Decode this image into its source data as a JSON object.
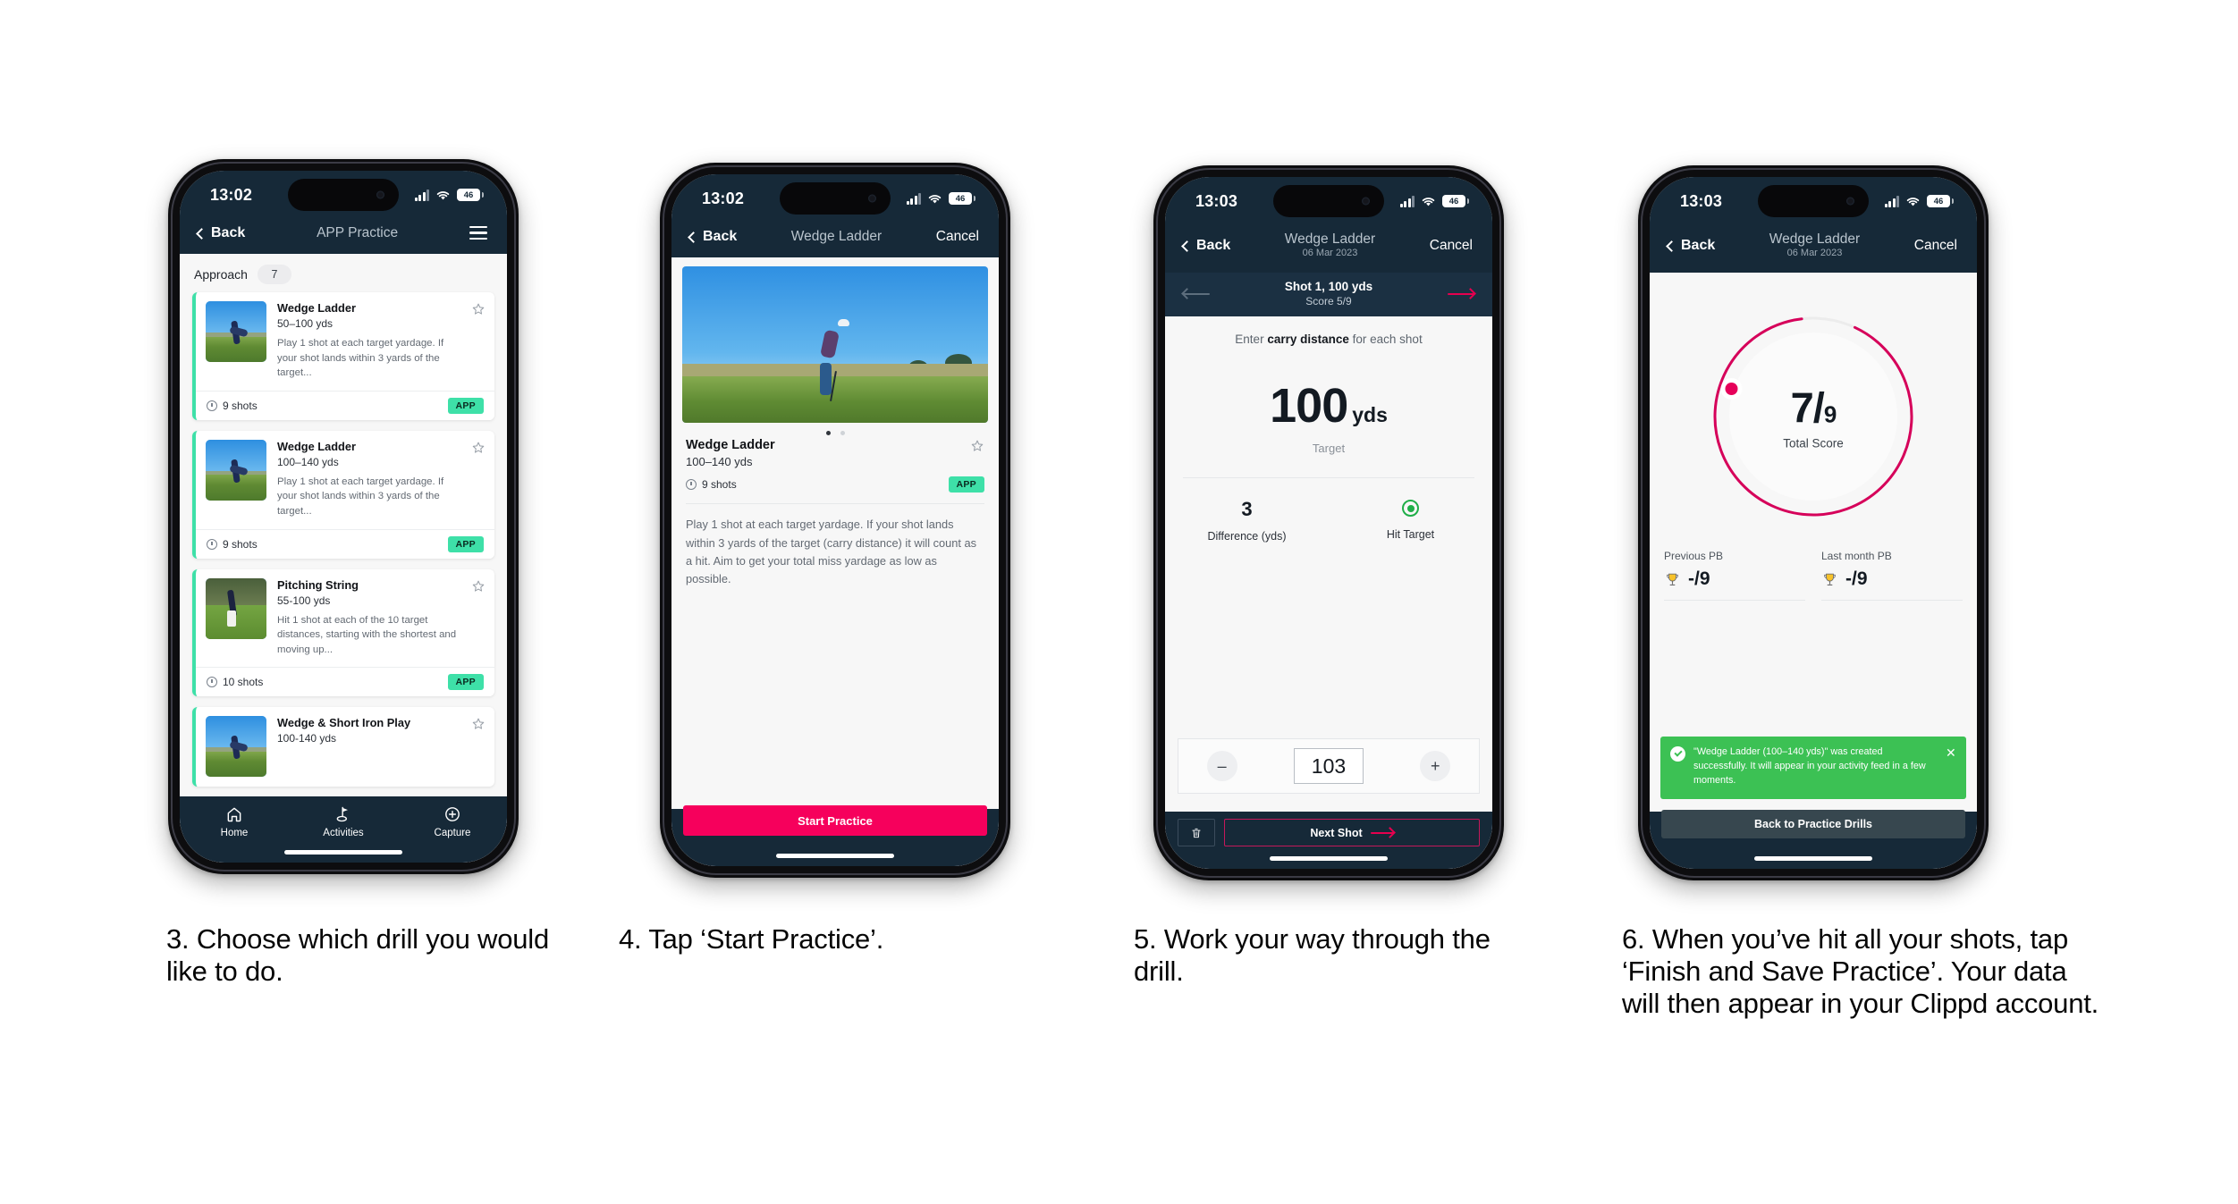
{
  "phones": [
    {
      "id": "phone-drill-list",
      "status": {
        "time": "13:02",
        "battery": "46"
      },
      "nav": {
        "back": "Back",
        "title": "APP Practice",
        "menu_icon": "hamburger-icon"
      },
      "section": {
        "title": "Approach",
        "count": "7"
      },
      "drills": [
        {
          "name": "Wedge Ladder",
          "range": "50–100 yds",
          "desc": "Play 1 shot at each target yardage. If your shot lands within 3 yards of the target...",
          "shots": "9 shots",
          "badge": "APP"
        },
        {
          "name": "Wedge Ladder",
          "range": "100–140 yds",
          "desc": "Play 1 shot at each target yardage. If your shot lands within 3 yards of the target...",
          "shots": "9 shots",
          "badge": "APP"
        },
        {
          "name": "Pitching String",
          "range": "55-100 yds",
          "desc": "Hit 1 shot at each of the 10 target distances, starting with the shortest and moving up...",
          "shots": "10 shots",
          "badge": "APP"
        },
        {
          "name": "Wedge & Short Iron Play",
          "range": "100-140 yds",
          "desc": "",
          "shots": "",
          "badge": ""
        }
      ],
      "tabs": [
        {
          "label": "Home",
          "icon": "home-icon"
        },
        {
          "label": "Activities",
          "icon": "golf-flag-icon"
        },
        {
          "label": "Capture",
          "icon": "plus-circle-icon"
        }
      ]
    },
    {
      "id": "phone-drill-detail",
      "status": {
        "time": "13:02",
        "battery": "46"
      },
      "nav": {
        "back": "Back",
        "title": "Wedge Ladder",
        "cancel": "Cancel"
      },
      "detail": {
        "title": "Wedge Ladder",
        "range": "100–140 yds",
        "shots": "9 shots",
        "badge": "APP",
        "description": "Play 1 shot at each target yardage. If your shot lands within 3 yards of the target (carry distance) it will count as a hit. Aim to get your total miss yardage as low as possible."
      },
      "cta": "Start Practice"
    },
    {
      "id": "phone-shot-entry",
      "status": {
        "time": "13:03",
        "battery": "46"
      },
      "nav": {
        "back": "Back",
        "title": "Wedge Ladder",
        "subtitle": "06 Mar 2023",
        "cancel": "Cancel"
      },
      "shotbar": {
        "title": "Shot 1, 100 yds",
        "score": "Score 5/9"
      },
      "hint_prefix": "Enter ",
      "hint_bold": "carry distance",
      "hint_suffix": " for each shot",
      "target": {
        "value": "100",
        "unit": "yds",
        "caption": "Target"
      },
      "stats": [
        {
          "value": "3",
          "label": "Difference (yds)"
        },
        {
          "value": "",
          "label": "Hit Target"
        }
      ],
      "stepper": {
        "minus": "–",
        "value": "103",
        "plus": "+"
      },
      "footer": {
        "delete_icon": "trash-icon",
        "next": "Next Shot"
      }
    },
    {
      "id": "phone-summary",
      "status": {
        "time": "13:03",
        "battery": "46"
      },
      "nav": {
        "back": "Back",
        "title": "Wedge Ladder",
        "subtitle": "06 Mar 2023",
        "cancel": "Cancel"
      },
      "ring": {
        "score": "7",
        "divider": "/",
        "total": "9",
        "label": "Total Score"
      },
      "pbs": [
        {
          "title": "Previous PB",
          "value": "-/9",
          "icon": "trophy-icon"
        },
        {
          "title": "Last month PB",
          "value": "-/9",
          "icon": "trophy-icon"
        }
      ],
      "toast": {
        "message": "\"Wedge Ladder (100–140 yds)\" was created successfully. It will appear in your activity feed in a few moments.",
        "close": "✕"
      },
      "button": "Back to Practice Drills"
    }
  ],
  "captions": [
    "3. Choose which drill you would like to do.",
    "4. Tap ‘Start Practice’.",
    "5. Work your way through the drill.",
    "6. When you’ve hit all your shots, tap ‘Finish and Save Practice’. Your data will then appear in your Clippd account."
  ],
  "colors": {
    "header": "#162938",
    "accent_pink": "#f6005c",
    "accent_green": "#3ee0a8",
    "toast_green": "#3cc154",
    "ring": "#d6005a"
  }
}
